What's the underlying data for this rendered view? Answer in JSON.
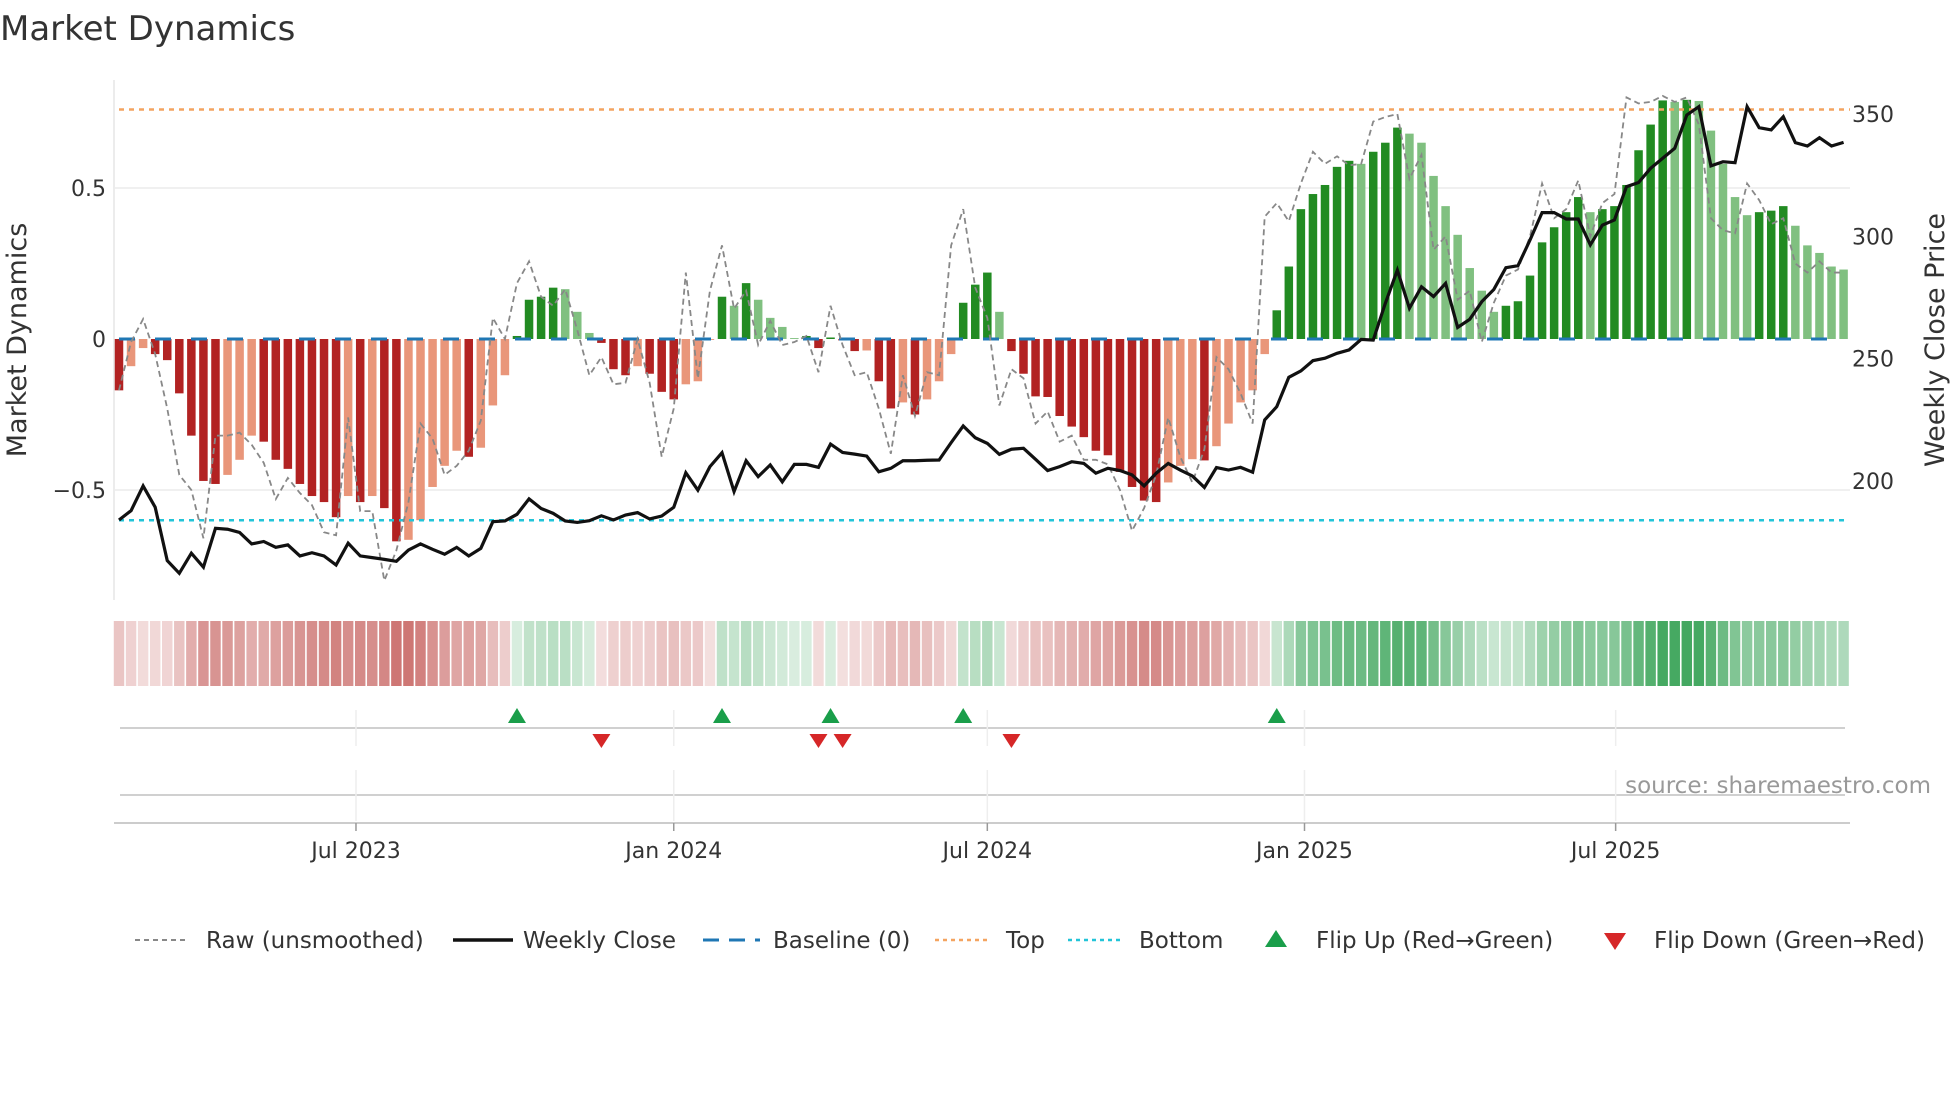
{
  "title": "Market Dynamics",
  "source": "source: sharemaestro.com",
  "colors": {
    "strong_red": "#b22222",
    "weak_red": "#e9967a",
    "strong_green": "#228b22",
    "weak_green": "#80c080",
    "raw": "#888888",
    "close": "#111111",
    "baseline": "#1f77b4",
    "top": "#f4a460",
    "bottom": "#22c4d8",
    "flip_up": "#1a9e4a",
    "flip_down": "#d62728",
    "heat_red": "#c0504d",
    "heat_green": "#2e9e4e"
  },
  "legend": [
    {
      "label": "Raw (unsmoothed)",
      "icon": "dashed-line"
    },
    {
      "label": "Weekly Close",
      "icon": "solid-line"
    },
    {
      "label": "Baseline (0)",
      "icon": "dashed-line"
    },
    {
      "label": "Top",
      "icon": "dotted-line"
    },
    {
      "label": "Bottom",
      "icon": "dotted-line"
    },
    {
      "label": "Flip Up (Red→Green)",
      "icon": "triangle-up"
    },
    {
      "label": "Flip Down (Green→Red)",
      "icon": "triangle-down"
    }
  ],
  "chart_data": {
    "type": "bar",
    "title": "Market Dynamics",
    "ylabel": "Market Dynamics",
    "y2label": "Weekly Close Price",
    "ylim": [
      -0.85,
      0.85
    ],
    "y_ticks": [
      {
        "v": 0.5,
        "label": "0.5"
      },
      {
        "v": 0,
        "label": "0"
      },
      {
        "v": -0.5,
        "label": "−0.5"
      }
    ],
    "y2_ticks": [
      {
        "v": 350,
        "label": "350"
      },
      {
        "v": 300,
        "label": "300"
      },
      {
        "v": 250,
        "label": "250"
      },
      {
        "v": 200,
        "label": "200"
      }
    ],
    "x_unit": "week index",
    "x_ticks": [
      {
        "week": 19.65,
        "label": "Jul 2023"
      },
      {
        "week": 46.0,
        "label": "Jan 2024"
      },
      {
        "week": 72.0,
        "label": "Jul 2024"
      },
      {
        "week": 98.3,
        "label": "Jan 2025"
      },
      {
        "week": 124.1,
        "label": "Jul 2025"
      }
    ],
    "top": 0.76,
    "bottom": -0.6,
    "baseline": 0,
    "values": [
      -0.17,
      -0.09,
      -0.03,
      -0.05,
      -0.07,
      -0.18,
      -0.32,
      -0.47,
      -0.48,
      -0.45,
      -0.4,
      -0.32,
      -0.34,
      -0.4,
      -0.43,
      -0.48,
      -0.52,
      -0.54,
      -0.59,
      -0.52,
      -0.54,
      -0.52,
      -0.56,
      -0.67,
      -0.665,
      -0.6,
      -0.49,
      -0.42,
      -0.37,
      -0.39,
      -0.36,
      -0.22,
      -0.12,
      0.01,
      0.13,
      0.14,
      0.17,
      0.165,
      0.09,
      0.02,
      -0.013,
      -0.1,
      -0.12,
      -0.09,
      -0.115,
      -0.175,
      -0.2,
      -0.15,
      -0.14,
      -0.003,
      0.14,
      0.11,
      0.185,
      0.13,
      0.07,
      0.04,
      0.003,
      0.01,
      -0.03,
      0.005,
      -0.005,
      -0.04,
      -0.038,
      -0.14,
      -0.23,
      -0.21,
      -0.25,
      -0.2,
      -0.14,
      -0.05,
      0.12,
      0.18,
      0.22,
      0.09,
      -0.04,
      -0.115,
      -0.19,
      -0.192,
      -0.255,
      -0.29,
      -0.325,
      -0.37,
      -0.385,
      -0.44,
      -0.49,
      -0.535,
      -0.54,
      -0.475,
      -0.42,
      -0.398,
      -0.402,
      -0.355,
      -0.28,
      -0.21,
      -0.17,
      -0.05,
      0.095,
      0.24,
      0.43,
      0.48,
      0.51,
      0.57,
      0.59,
      0.58,
      0.62,
      0.65,
      0.7,
      0.68,
      0.65,
      0.54,
      0.44,
      0.345,
      0.235,
      0.16,
      0.09,
      0.11,
      0.125,
      0.21,
      0.32,
      0.37,
      0.42,
      0.47,
      0.42,
      0.43,
      0.44,
      0.51,
      0.625,
      0.71,
      0.79,
      0.785,
      0.792,
      0.788,
      0.69,
      0.58,
      0.47,
      0.41,
      0.42,
      0.425,
      0.44,
      0.375,
      0.31,
      0.285,
      0.24,
      0.23
    ],
    "raw": [
      -0.17,
      -0.01,
      0.066,
      -0.05,
      -0.23,
      -0.45,
      -0.5,
      -0.66,
      -0.32,
      -0.32,
      -0.31,
      -0.35,
      -0.41,
      -0.53,
      -0.46,
      -0.51,
      -0.55,
      -0.64,
      -0.65,
      -0.26,
      -0.57,
      -0.57,
      -0.8,
      -0.7,
      -0.54,
      -0.28,
      -0.33,
      -0.45,
      -0.42,
      -0.37,
      -0.27,
      0.07,
      0.0,
      0.185,
      0.257,
      0.14,
      0.11,
      0.165,
      0.03,
      -0.12,
      -0.06,
      -0.15,
      -0.145,
      0.0,
      -0.145,
      -0.39,
      -0.23,
      0.22,
      -0.13,
      0.16,
      0.31,
      0.1,
      0.16,
      -0.02,
      0.06,
      -0.02,
      -0.01,
      0.01,
      -0.11,
      0.11,
      -0.02,
      -0.12,
      -0.11,
      -0.23,
      -0.38,
      -0.12,
      -0.255,
      -0.11,
      -0.12,
      0.31,
      0.43,
      0.17,
      0.07,
      -0.22,
      -0.1,
      -0.13,
      -0.28,
      -0.24,
      -0.34,
      -0.32,
      -0.4,
      -0.4,
      -0.415,
      -0.5,
      -0.635,
      -0.56,
      -0.45,
      -0.26,
      -0.39,
      -0.475,
      -0.365,
      -0.06,
      -0.1,
      -0.18,
      -0.28,
      0.405,
      0.45,
      0.39,
      0.515,
      0.62,
      0.58,
      0.605,
      0.575,
      0.58,
      0.72,
      0.735,
      0.745,
      0.53,
      0.61,
      0.295,
      0.34,
      0.13,
      0.16,
      -0.01,
      0.12,
      0.21,
      0.23,
      0.34,
      0.515,
      0.4,
      0.43,
      0.525,
      0.34,
      0.45,
      0.48,
      0.8,
      0.78,
      0.785,
      0.805,
      0.785,
      0.8,
      0.71,
      0.4,
      0.36,
      0.35,
      0.515,
      0.46,
      0.38,
      0.4,
      0.25,
      0.22,
      0.257,
      0.22,
      0.22
    ],
    "close": [
      184.1,
      187.9,
      198.0,
      189.3,
      167.5,
      162.3,
      170.5,
      164.8,
      180.7,
      180.3,
      179.0,
      174.3,
      175.3,
      172.9,
      173.9,
      169.4,
      170.7,
      169.4,
      165.7,
      174.6,
      169.4,
      168.7,
      168.0,
      167.2,
      171.8,
      174.3,
      172.1,
      170.1,
      172.9,
      169.4,
      172.5,
      183.4,
      183.7,
      186.4,
      192.7,
      188.8,
      186.8,
      183.7,
      183.1,
      183.8,
      185.8,
      184.1,
      186.1,
      187.1,
      184.5,
      185.7,
      189.3,
      203.4,
      196.3,
      205.9,
      211.6,
      195.7,
      208.3,
      201.8,
      206.6,
      199.7,
      206.8,
      206.8,
      205.6,
      215.1,
      211.7,
      211.0,
      210.2,
      203.8,
      205.2,
      208.3,
      208.3,
      208.5,
      208.6,
      215.7,
      222.5,
      217.7,
      215.4,
      210.9,
      213.0,
      213.4,
      208.9,
      204.3,
      205.9,
      207.9,
      207.2,
      203.2,
      205.2,
      204.3,
      202.5,
      198.0,
      203.2,
      207.2,
      204.5,
      202.1,
      197.4,
      205.5,
      204.5,
      205.6,
      203.6,
      225.0,
      230.4,
      242.4,
      245.0,
      249.2,
      250.2,
      252.2,
      253.6,
      257.9,
      257.6,
      272.6,
      286.2,
      270.6,
      279.4,
      275.4,
      280.8,
      262.8,
      266.1,
      273.3,
      278.3,
      287.2,
      288.0,
      298.5,
      309.7,
      309.7,
      307.1,
      307.1,
      296.5,
      304.6,
      306.7,
      320.3,
      322.0,
      327.8,
      331.9,
      336.0,
      349.6,
      353.0,
      328.8,
      330.5,
      330.1,
      353.0,
      344.4,
      343.5,
      348.9,
      338.3,
      336.9,
      340.3,
      336.9,
      338.4
    ],
    "flips_up": [
      34,
      51,
      60,
      71,
      97
    ],
    "flips_down": [
      41,
      59,
      61,
      75
    ]
  }
}
